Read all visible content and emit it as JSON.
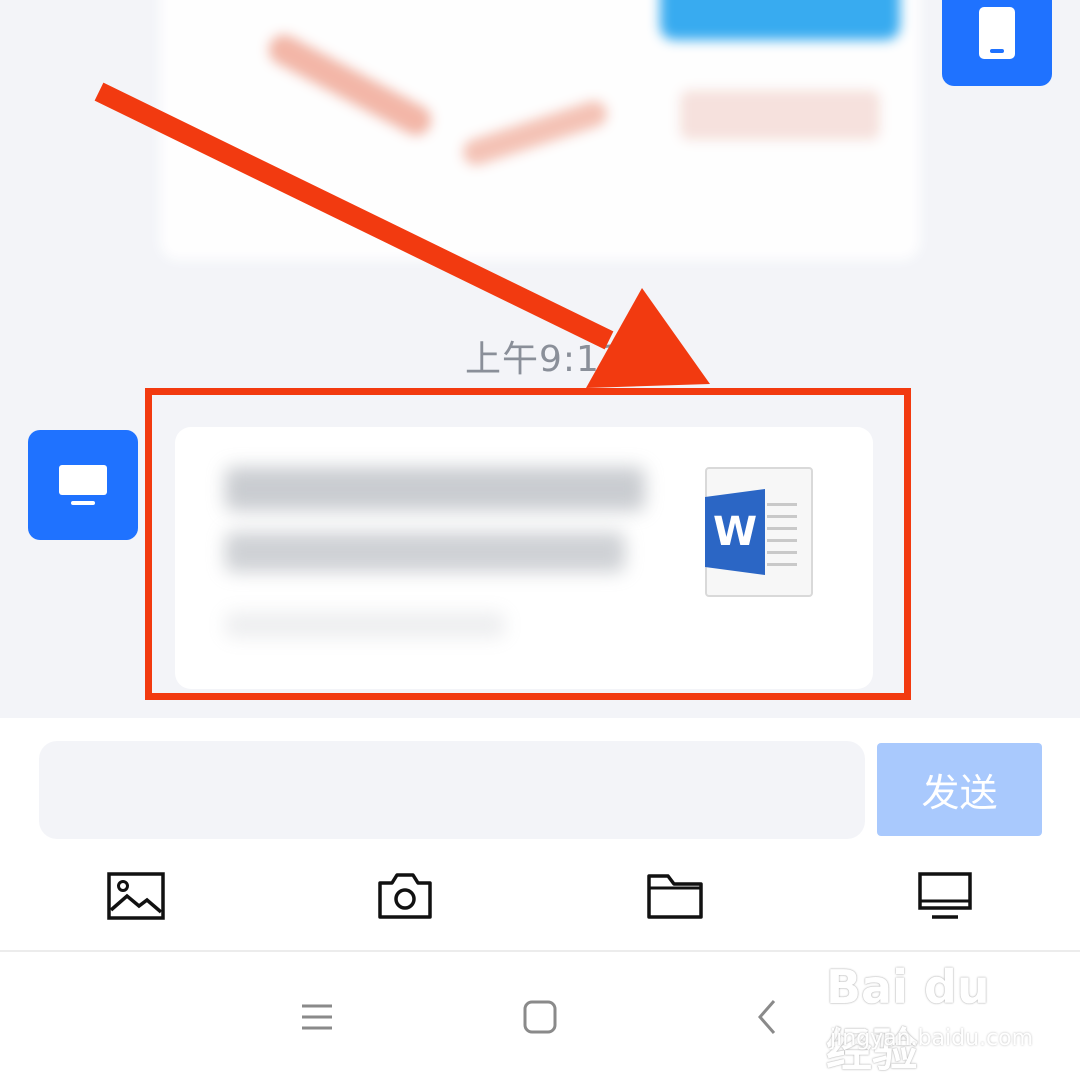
{
  "chat": {
    "timestamp": "上午9:13",
    "file_message": {
      "file_type_icon": "word-document-icon",
      "file_type_letter": "W"
    },
    "avatars": {
      "me": "phone-icon",
      "pc": "computer-icon"
    }
  },
  "composer": {
    "input_value": "",
    "send_label": "发送"
  },
  "toolbar": {
    "items": [
      "image-icon",
      "camera-icon",
      "folder-icon",
      "computer-icon"
    ]
  },
  "nav": {
    "items": [
      "menu-icon",
      "home-icon",
      "back-icon"
    ]
  },
  "watermark": {
    "logo": "Bai du 经验",
    "url": "jingyan.baidu.com"
  },
  "colors": {
    "accent": "#1f72ff",
    "send_disabled": "#a9c9fd",
    "annotation_red": "#f23a10",
    "chat_background": "#f3f4f8"
  }
}
